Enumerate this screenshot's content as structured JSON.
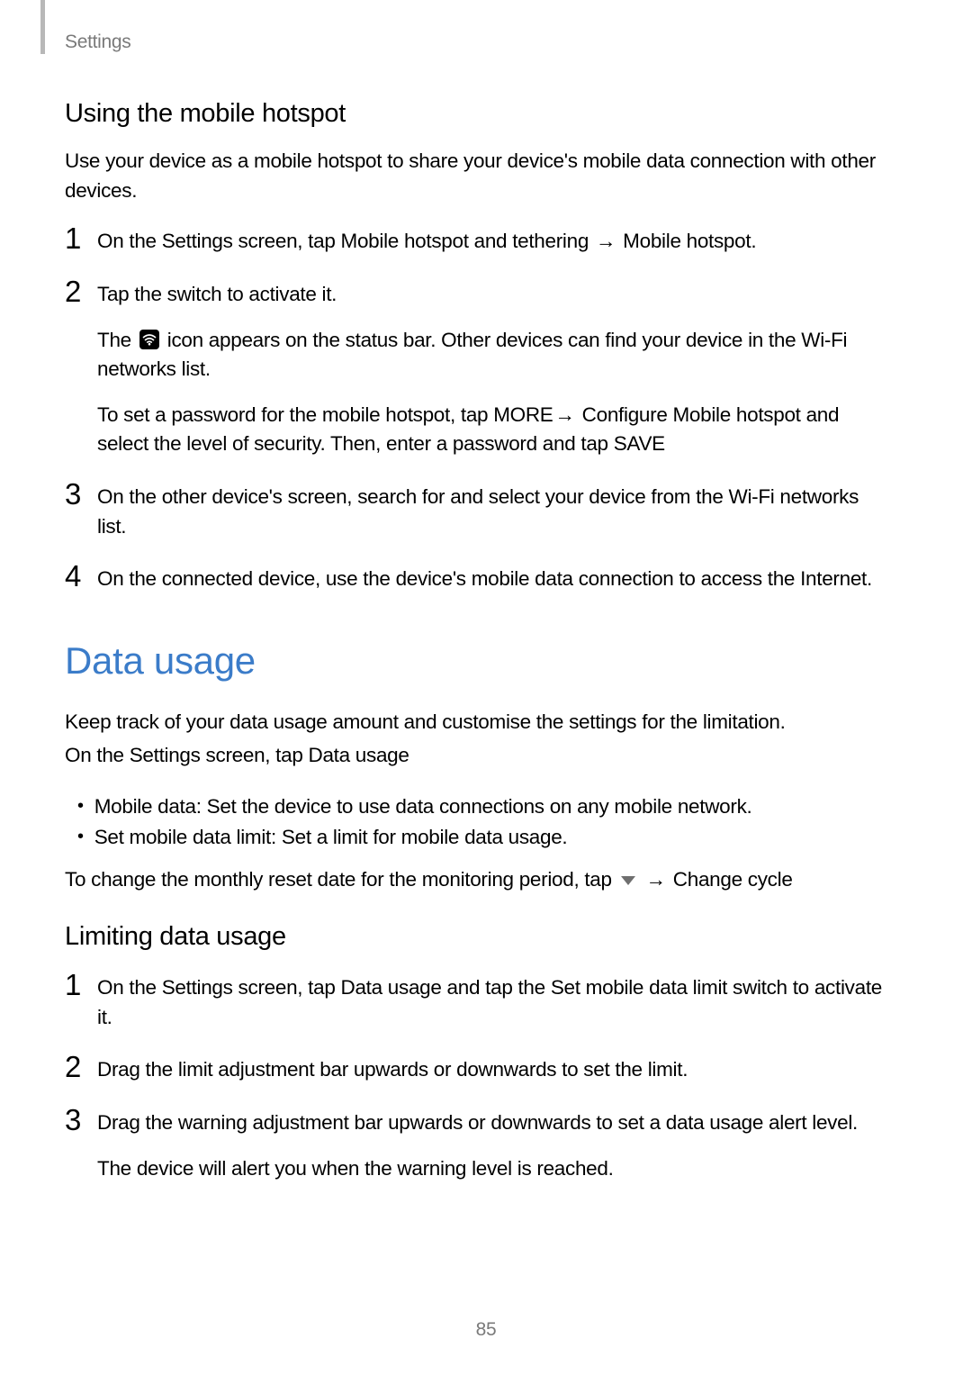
{
  "header": {
    "section": "Settings"
  },
  "s1": {
    "title": "Using the mobile hotspot",
    "intro": "Use your device as a mobile hotspot to share your device's mobile data connection with other devices.",
    "step1": {
      "n": "1",
      "pre": "On the Settings screen, tap ",
      "menu1": "Mobile hotspot and tethering",
      "arrow": " → ",
      "menu2": "Mobile hotspot",
      "post": "."
    },
    "step2": {
      "n": "2",
      "line1": "Tap the switch to activate it.",
      "sub1_pre": "The ",
      "sub1_post": " icon appears on the status bar. Other devices can find your device in the Wi-Fi networks list.",
      "sub2_pre": "To set a password for the mobile hotspot, tap ",
      "sub2_m1": "MORE",
      "sub2_arrow": "→ ",
      "sub2_m2": "Configure Mobile hotspot",
      "sub2_mid": " and select the level of security. Then, enter a password and tap ",
      "sub2_m3": "SAVE"
    },
    "step3": {
      "n": "3",
      "text": "On the other device's screen, search for and select your device from the Wi-Fi networks list."
    },
    "step4": {
      "n": "4",
      "text": "On the connected device, use the device's mobile data connection to access the Internet."
    }
  },
  "s2": {
    "title": "Data usage",
    "p1": "Keep track of your data usage amount and customise the settings for the limitation.",
    "p2_pre": "On the Settings screen, tap ",
    "p2_menu": "Data usage",
    "b1_label": "Mobile data",
    "b1_text": ": Set the device to use data connections on any mobile network.",
    "b2_label": "Set mobile data limit",
    "b2_text": ": Set a limit for mobile data usage.",
    "p3_pre": "To change the monthly reset date for the monitoring period, tap ",
    "p3_arrow": " → ",
    "p3_menu": "Change cycle"
  },
  "s3": {
    "title": "Limiting data usage",
    "step1": {
      "n": "1",
      "pre": "On the Settings screen, tap ",
      "m1": "Data usage",
      "mid": " and tap the ",
      "m2": "Set mobile data limit",
      "post": " switch to activate it."
    },
    "step2": {
      "n": "2",
      "text": "Drag the limit adjustment bar upwards or downwards to set the limit."
    },
    "step3": {
      "n": "3",
      "line1": "Drag the warning adjustment bar upwards or downwards to set a data usage alert level.",
      "line2": "The device will alert you when the warning level is reached."
    }
  },
  "page": "85"
}
